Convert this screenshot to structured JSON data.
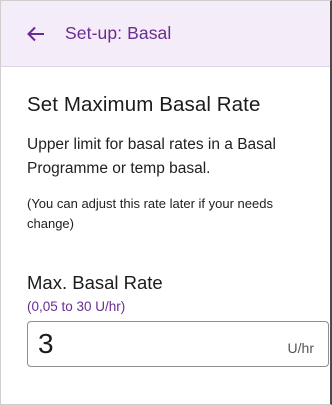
{
  "appbar": {
    "title": "Set-up: Basal",
    "back_icon": "arrow-left-icon",
    "accent_color": "#6a2c91",
    "background_color": "#f4ecf8"
  },
  "main": {
    "heading": "Set Maximum Basal Rate",
    "description": "Upper limit for basal rates in a Basal Programme or temp basal.",
    "note": "(You can adjust this rate later if your needs change)",
    "field": {
      "label": "Max. Basal Rate",
      "range": "(0,05 to 30 U/hr)",
      "value": "3",
      "unit": "U/hr"
    }
  }
}
